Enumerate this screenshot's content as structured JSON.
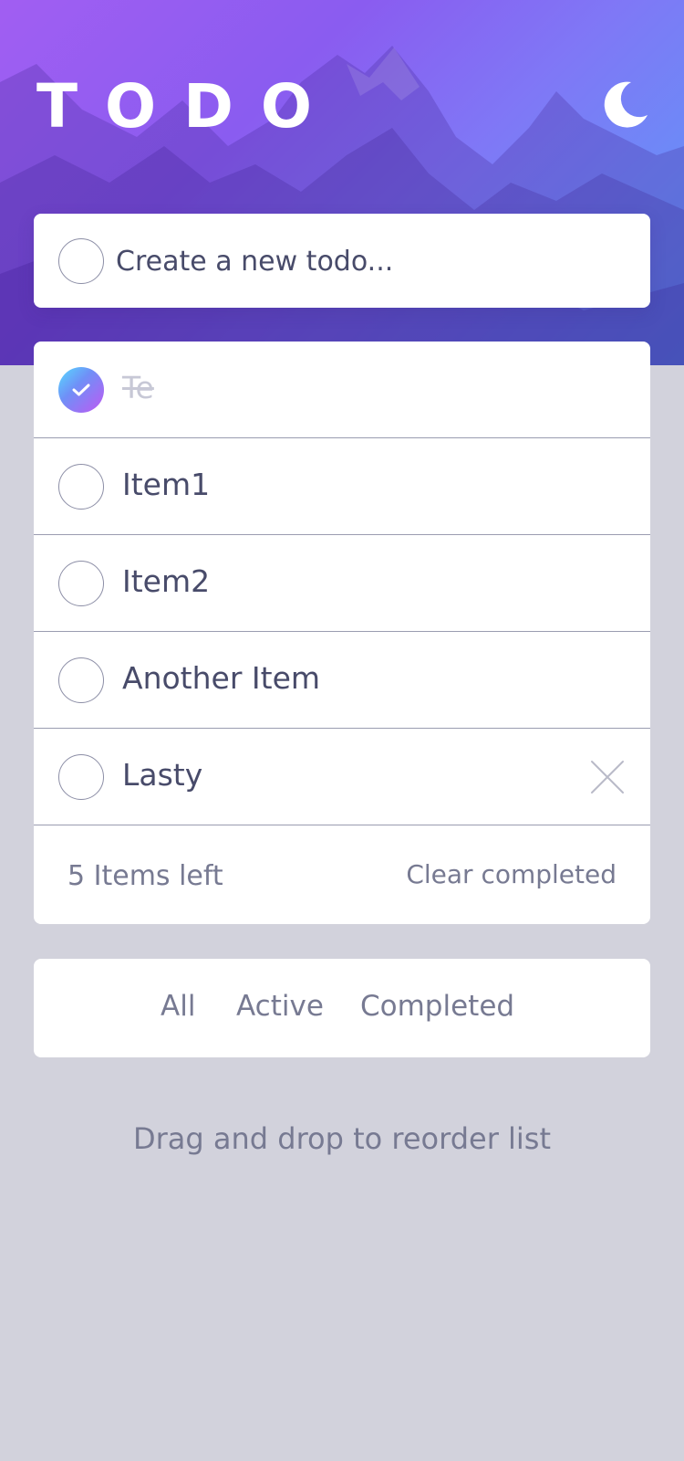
{
  "header": {
    "title": "TODO",
    "theme_icon": "moon-icon"
  },
  "new_todo": {
    "placeholder": "Create a new todo..."
  },
  "todos": [
    {
      "label": "Te",
      "completed": true
    },
    {
      "label": "Item1",
      "completed": false
    },
    {
      "label": "Item2",
      "completed": false
    },
    {
      "label": "Another Item",
      "completed": false
    },
    {
      "label": "Lasty",
      "completed": false
    }
  ],
  "footer": {
    "items_left": "5 Items left",
    "clear_label": "Clear completed"
  },
  "filters": {
    "all": "All",
    "active": "Active",
    "completed": "Completed"
  },
  "hint": "Drag and drop to reorder list",
  "colors": {
    "background": "#d2d2dc",
    "card": "#ffffff",
    "text": "#484b6a",
    "muted": "#777a92",
    "check_gradient": [
      "#57ddff",
      "#c058f3"
    ]
  }
}
